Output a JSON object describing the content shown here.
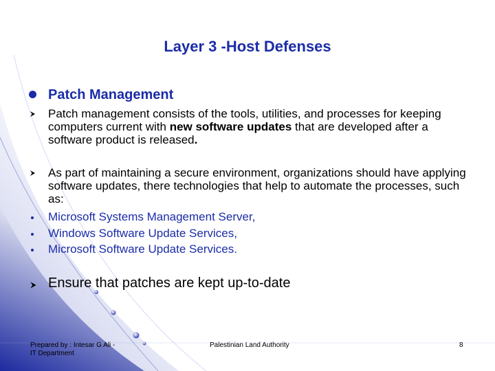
{
  "slide": {
    "title": "Layer 3 -Host Defenses",
    "heading": "Patch Management",
    "p1": {
      "before": "Patch management consists of the tools, utilities, and processes for keeping computers current with ",
      "bold": "new software updates",
      "after": " that are developed after a software product is released",
      "end": "."
    },
    "p2": " As part of maintaining a secure environment, organizations should have applying software updates, there technologies that help to automate the processes, such as:",
    "items": [
      "Microsoft Systems Management Server,",
      "Windows Software Update Services,",
      "Microsoft Software Update Services."
    ],
    "last": "Ensure that patches are kept up-to-date"
  },
  "footer": {
    "left_line1": "Prepared by : Intesar G Ali -",
    "left_line2": "IT Department",
    "center": "Palestinian Land Authority",
    "page": "8"
  },
  "colors": {
    "accent": "#1b2ca8",
    "decor_gradient_dark": "#1c2a9e",
    "decor_gradient_light": "#c6cbee"
  },
  "icons": {
    "heading_bullet": "filled-circle",
    "paragraph_bullet": "arrowhead",
    "item_bullet": "small-dot"
  }
}
